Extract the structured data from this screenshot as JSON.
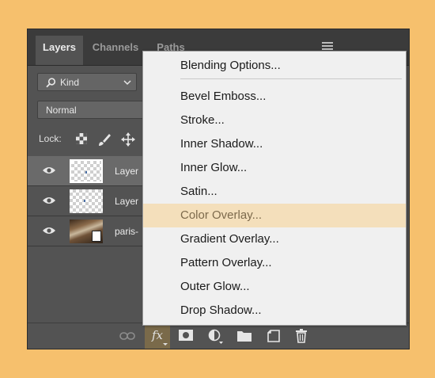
{
  "panel": {
    "tabs": [
      {
        "label": "Layers",
        "active": true
      },
      {
        "label": "Channels",
        "active": false
      },
      {
        "label": "Paths",
        "active": false
      }
    ]
  },
  "filter": {
    "kind_label": "Kind"
  },
  "blend_mode": {
    "value": "Normal"
  },
  "lock": {
    "label": "Lock:"
  },
  "layers": [
    {
      "name": "Layer",
      "selected": true
    },
    {
      "name": "Layer",
      "selected": false
    },
    {
      "name": "paris-",
      "selected": false
    }
  ],
  "footer": {
    "fx_label": "fx"
  },
  "fx_menu": {
    "items": [
      "Blending Options...",
      "Bevel  Emboss...",
      "Stroke...",
      "Inner Shadow...",
      "Inner Glow...",
      "Satin...",
      "Color Overlay...",
      "Gradient Overlay...",
      "Pattern Overlay...",
      "Outer Glow...",
      "Drop Shadow..."
    ],
    "highlighted": "Color Overlay..."
  },
  "colors": {
    "background": "#f6c06d",
    "panel": "#535353",
    "menu_highlight": "#f4dfbb"
  }
}
